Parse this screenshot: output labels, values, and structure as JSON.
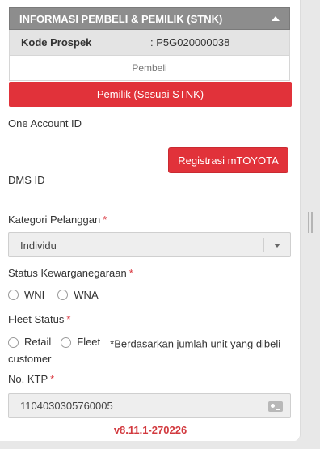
{
  "section": {
    "title": "INFORMASI PEMBELI & PEMILIK (STNK)"
  },
  "prospek": {
    "label": "Kode Prospek",
    "value": ": P5G020000038"
  },
  "tabs": {
    "pembeli": "Pembeli",
    "pemilik": "Pemilik (Sesuai STNK)",
    "active": "pemilik"
  },
  "fields": {
    "one_account_label": "One Account ID",
    "registrasi_button": "Registrasi mTOYOTA",
    "dms_label": "DMS ID",
    "kategori_label": "Kategori Pelanggan",
    "kategori_value": "Individu",
    "kewarganegaraan_label": "Status Kewarganegaraan",
    "kewarganegaraan_options": [
      "WNI",
      "WNA"
    ],
    "fleet_label": "Fleet Status",
    "fleet_options": [
      "Retail",
      "Fleet"
    ],
    "fleet_note": "*Berdasarkan jumlah unit yang dibeli customer",
    "ktp_label": "No. KTP",
    "ktp_value": "1104030305760005",
    "required_marker": "*"
  },
  "footer": {
    "version": "v8.11.1-270226"
  },
  "colors": {
    "accent": "#e1323a",
    "header_bg": "#8d8d8d"
  }
}
